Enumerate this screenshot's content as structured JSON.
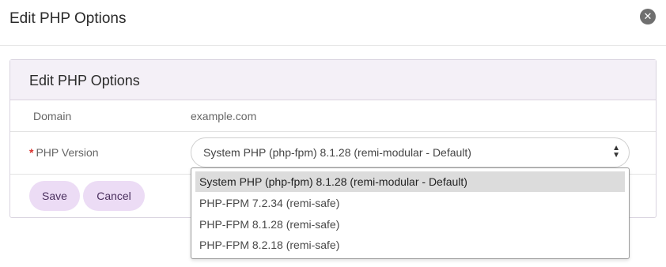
{
  "modal": {
    "title": "Edit PHP Options",
    "close_icon": "close-icon"
  },
  "panel": {
    "title": "Edit PHP Options",
    "domain_label": "Domain",
    "domain_value": "example.com",
    "php_label": "PHP Version",
    "required_marker": "*",
    "php_selected": "System PHP (php-fpm) 8.1.28 (remi-modular - Default)",
    "caret_icon": "updown-caret-icon"
  },
  "buttons": {
    "save": "Save",
    "cancel": "Cancel"
  },
  "dropdown": {
    "options": [
      "System PHP (php-fpm) 8.1.28 (remi-modular - Default)",
      "PHP-FPM 7.2.34 (remi-safe)",
      "PHP-FPM 8.1.28 (remi-safe)",
      "PHP-FPM 8.2.18 (remi-safe)"
    ],
    "highlighted_index": 0
  },
  "colors": {
    "button_bg": "#ecdcf5",
    "panel_header_bg": "#f4f0f7",
    "required": "#d9302b",
    "highlight": "#dcdcdc"
  }
}
